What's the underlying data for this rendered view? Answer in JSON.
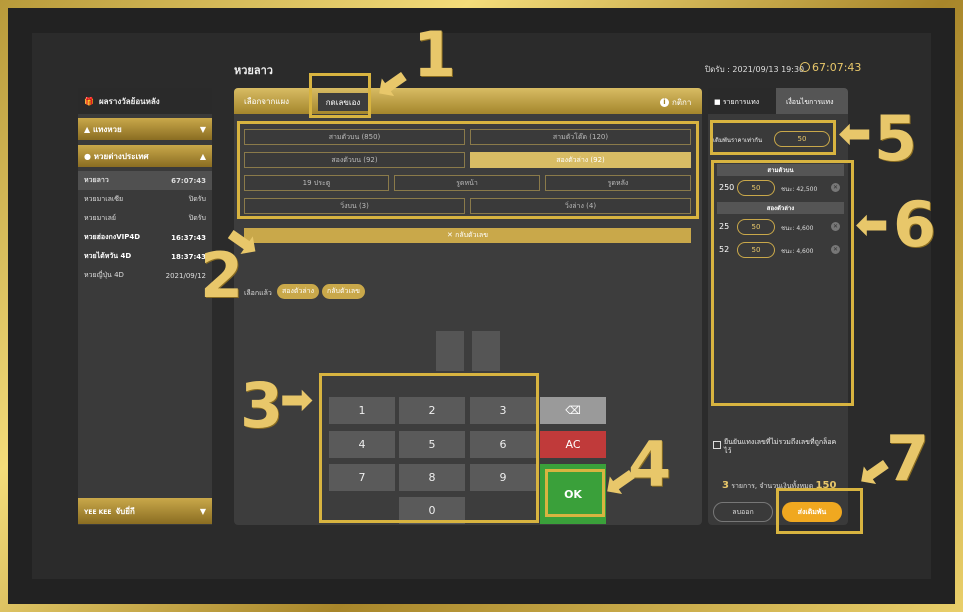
{
  "header": {
    "title": "หวยลาว",
    "close_time": "ปิดรับ : 2021/09/13 19:30",
    "countdown": "67:07:43"
  },
  "sidebar": {
    "results_label": "ผลรางวัลย้อนหลัง",
    "lottery_label": "แทงหวย",
    "foreign_label": "หวยต่างประเทศ",
    "items": [
      {
        "name": "หวยลาว",
        "value": "67:07:43"
      },
      {
        "name": "หวยมาเลเซีย",
        "value": "ปิดรับ"
      },
      {
        "name": "หวยมาเลย์",
        "value": "ปิดรับ"
      },
      {
        "name": "หวยฮ่องกงVIP4D",
        "value": "16:37:43"
      },
      {
        "name": "หวยไต้หวัน 4D",
        "value": "18:37:43"
      },
      {
        "name": "หวยญี่ปุ่น 4D",
        "value": "2021/09/12"
      }
    ],
    "footer_brand": "YEE KEE",
    "footer_label": "จับยี่กี"
  },
  "center": {
    "tab_panel": "เลือกจากแผง",
    "tab_manual": "กดเลขเอง",
    "rules": "กติกา",
    "options": [
      "สามตัวบน (850)",
      "สามตัวโต๊ด (120)",
      "สองตัวบน (92)",
      "สองตัวล่าง (92)",
      "19 ประตู",
      "รูดหน้า",
      "รูดหลัง",
      "วิ่งบน (3)",
      "วิ่งล่าง (4)"
    ],
    "reverse": "✕ กลับตัวเลข",
    "selected_label": "เลือกแล้ว",
    "chips": [
      "สองตัวล่าง",
      "กลับตัวเลข"
    ]
  },
  "keypad": {
    "keys": [
      "1",
      "2",
      "3",
      "4",
      "5",
      "6",
      "7",
      "8",
      "9",
      "0"
    ],
    "del": "⌫",
    "ac": "AC",
    "ok": "OK"
  },
  "right": {
    "tab_list": "รายการแทง",
    "tab_conditions": "เงื่อนไขการแทง",
    "same_price_label": "เดิมพันราคาเท่ากัน",
    "same_price_value": "50",
    "groups": [
      {
        "title": "สามตัวบน",
        "rows": [
          {
            "num": "250",
            "amount": "50",
            "win": "ชนะ: 42,500"
          }
        ]
      },
      {
        "title": "สองตัวล่าง",
        "rows": [
          {
            "num": "25",
            "amount": "50",
            "win": "ชนะ: 4,600"
          },
          {
            "num": "52",
            "amount": "50",
            "win": "ชนะ: 4,600"
          }
        ]
      }
    ],
    "confirm_text": "ยืนยันแทงเลขที่ไม่รวมถึงเลขที่ถูกล็อคไว้",
    "summary_count": "3",
    "summary_text": "รายการ, จำนวนเงินทั้งหมด",
    "summary_total": "150",
    "clear": "ลบออก",
    "submit": "ส่งเดิมพัน"
  },
  "annotations": [
    "1",
    "2",
    "3",
    "4",
    "5",
    "6",
    "7"
  ]
}
